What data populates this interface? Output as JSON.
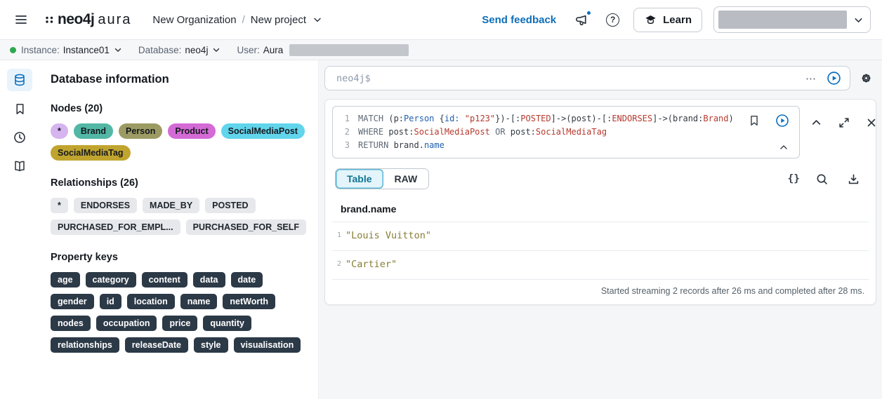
{
  "colors": {
    "accent_blue": "#0a70c0",
    "link_blue": "#0e6eb8",
    "tok_keyword": "#5f6a76",
    "tok_plain": "#333a42",
    "tok_blue": "#2160ad",
    "tok_red": "#b53a2e",
    "result_string": "#887e36",
    "tab_active_bg": "#e3f4fa",
    "tab_active_text": "#0f7493",
    "status_green": "#2fa84f"
  },
  "logo": {
    "name": "neo4j",
    "product": "aura"
  },
  "header": {
    "breadcrumb": {
      "org": "New Organization",
      "sep": "/",
      "project": "New project"
    },
    "send_feedback": "Send feedback",
    "help_glyph": "?",
    "learn": "Learn"
  },
  "instance_bar": {
    "instance_label": "Instance:",
    "instance_value": "Instance01",
    "database_label": "Database:",
    "database_value": "neo4j",
    "user_label": "User:",
    "user_value": "Aura"
  },
  "sidebar_panel": {
    "title": "Database information",
    "nodes_title": "Nodes (20)",
    "node_badges": [
      {
        "label": "*",
        "bg": "#d5b4f0"
      },
      {
        "label": "Brand",
        "bg": "#52b7a5"
      },
      {
        "label": "Person",
        "bg": "#9c9b63"
      },
      {
        "label": "Product",
        "bg": "#d46ad6"
      },
      {
        "label": "SocialMediaPost",
        "bg": "#61d5ec"
      },
      {
        "label": "SocialMediaTag",
        "bg": "#c0a42e"
      }
    ],
    "relationships_title": "Relationships (26)",
    "relationship_badges": [
      "*",
      "ENDORSES",
      "MADE_BY",
      "POSTED",
      "PURCHASED_FOR_EMPL...",
      "PURCHASED_FOR_SELF"
    ],
    "property_keys_title": "Property keys",
    "property_badges": [
      "age",
      "category",
      "content",
      "data",
      "date",
      "gender",
      "id",
      "location",
      "name",
      "netWorth",
      "nodes",
      "occupation",
      "price",
      "quantity",
      "relationships",
      "releaseDate",
      "style",
      "visualisation"
    ]
  },
  "query_bar": {
    "placeholder": "neo4j$",
    "more_glyph": "⋯"
  },
  "editor": {
    "lines": [
      [
        {
          "t": "MATCH ",
          "c": "k"
        },
        {
          "t": "(p:",
          "c": "p"
        },
        {
          "t": "Person",
          "c": "b"
        },
        {
          "t": " {",
          "c": "p"
        },
        {
          "t": "id:",
          "c": "b"
        },
        {
          "t": " ",
          "c": "p"
        },
        {
          "t": "\"p123\"",
          "c": "r"
        },
        {
          "t": "})-[:",
          "c": "p"
        },
        {
          "t": "POSTED",
          "c": "r"
        },
        {
          "t": "]->(post)-[:",
          "c": "p"
        },
        {
          "t": "ENDORSES",
          "c": "r"
        },
        {
          "t": "]->(brand:",
          "c": "p"
        },
        {
          "t": "Brand",
          "c": "r"
        },
        {
          "t": ")",
          "c": "p"
        }
      ],
      [
        {
          "t": "WHERE ",
          "c": "k"
        },
        {
          "t": "post:",
          "c": "p"
        },
        {
          "t": "SocialMediaPost",
          "c": "r"
        },
        {
          "t": " ",
          "c": "p"
        },
        {
          "t": "OR",
          "c": "k"
        },
        {
          "t": " post:",
          "c": "p"
        },
        {
          "t": "SocialMediaTag",
          "c": "r"
        }
      ],
      [
        {
          "t": "RETURN ",
          "c": "k"
        },
        {
          "t": "brand.",
          "c": "p"
        },
        {
          "t": "name",
          "c": "b"
        }
      ]
    ]
  },
  "results": {
    "tabs": [
      {
        "label": "Table",
        "active": true
      },
      {
        "label": "RAW",
        "active": false
      }
    ],
    "braces_glyph": "{}",
    "column": "brand.name",
    "rows": [
      {
        "num": "1",
        "value": "\"Louis Vuitton\""
      },
      {
        "num": "2",
        "value": "\"Cartier\""
      }
    ],
    "status": "Started streaming 2 records after 26 ms and completed after 28 ms."
  }
}
